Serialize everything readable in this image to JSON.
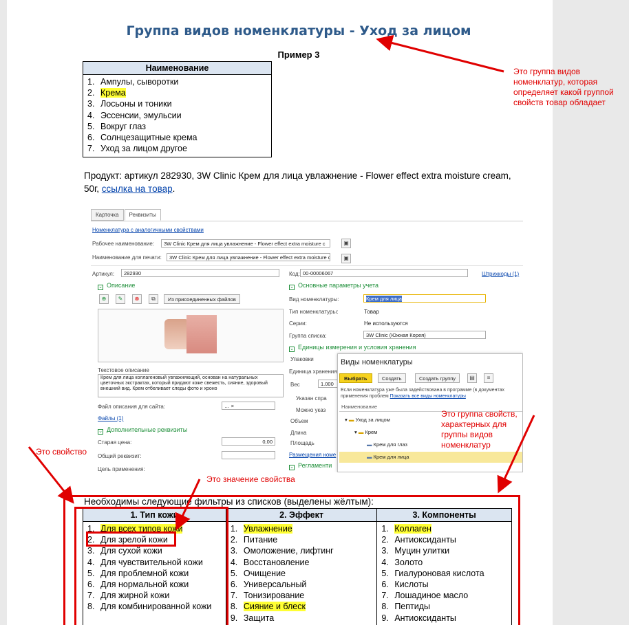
{
  "title": "Группа видов номенклатуры - Уход за лицом",
  "example": "Пример 3",
  "table1": {
    "header": "Наименование",
    "items": [
      {
        "n": "1.",
        "text": "Ампулы, сыворотки",
        "hl": false
      },
      {
        "n": "2.",
        "text": "Крема",
        "hl": true
      },
      {
        "n": "3.",
        "text": "Лосьоны и тоники",
        "hl": false
      },
      {
        "n": "4.",
        "text": "Эссенсии, эмульсии",
        "hl": false
      },
      {
        "n": "5.",
        "text": "Вокруг глаз",
        "hl": false
      },
      {
        "n": "6.",
        "text": "Солнцезащитные крема",
        "hl": false
      },
      {
        "n": "7.",
        "text": "Уход за лицом другое",
        "hl": false
      }
    ]
  },
  "product": {
    "text": "Продукт: артикул 282930, 3W Clinic Крем для лица увлажнение - Flower effect extra moisture cream, 50г, ",
    "link": "ссылка на товар",
    "after": "."
  },
  "screenshot": {
    "tabs": [
      "Карточка",
      "Реквизиты"
    ],
    "link_similar": "Номенклатура с аналогичными свойствами",
    "work_name_label": "Рабочее наименование:",
    "work_name_value": "3W Clinic Крем для лица увлажнение - Flower effect extra moisture c",
    "print_name_label": "Наименование для печати:",
    "print_name_value": "3W Clinic Крем для лица увлажнение - Flower effect extra moisture c",
    "article_label": "Артикул:",
    "article_value": "282930",
    "code_label": "Код:",
    "code_value": "00-00006067",
    "barcodes_link": "Штрихкоды (1)",
    "section_desc": "Описание",
    "from_files_btn": "Из присоединенных файлов",
    "section_main": "Основные параметры учета",
    "kind_label": "Вид номенклатуры:",
    "kind_value": "Крем для лица",
    "type_label": "Тип номенклатуры:",
    "type_value": "Товар",
    "series_label": "Серии:",
    "series_value": "Не используются",
    "group_label": "Группа списка:",
    "group_value": "3W Clinic (Южная Корея)",
    "section_units": "Единицы измерения и условия хранения",
    "pack_label": "Упаковки",
    "unit_label": "Единица хранения",
    "weight_label": "Вес",
    "weight_value": "1.000",
    "radio1": "Указан спра",
    "radio2": "Можно указ",
    "volume_label": "Объем",
    "length_label": "Длина",
    "area_label": "Площадь",
    "placement_link": "Размещения номе",
    "section_reg": "Регламенти",
    "text_desc_label": "Текстовое описание",
    "text_desc": "Крем для лица коллагеновый увлажняющий, основан на натуральных цветочных экстрактах, который придают коже свежесть, сияние, здоровый внешний вид. Крем отбеливает следы фото и хроно",
    "file_desc_label": "Файл описания для сайта:",
    "files_link": "Файлы (1)",
    "section_extra": "Дополнительные реквизиты",
    "old_price_label": "Старая цена:",
    "old_price_value": "0,00",
    "common_attr_label": "Общий реквизит:",
    "purpose_label": "Цель применения:",
    "popup": {
      "title": "Виды номенклатуры",
      "select_btn": "Выбрать",
      "create_btn": "Создать",
      "create_group_btn": "Создать группу",
      "note": "Если номенклатура уже была задействована в программе (в документах применения проблем ",
      "note_link": "Показать все виды номенклатуры",
      "col": "Наименование",
      "rows": [
        "Уход за лицом",
        "Крем",
        "Крем для глаз",
        "Крем для лица"
      ]
    }
  },
  "annotations": {
    "group_note": "Это группа видов номенклатур, которая определяет какой группой свойств товар обладает",
    "props_note": "Это группа свойств, характерных для группы видов номенклатур",
    "property_note": "Это свойство",
    "value_note": "Это значение свойства"
  },
  "need_text": "Необходимы следующие фильтры из списков (выделены жёлтым):",
  "table2": {
    "headers": [
      "1. Тип кожи",
      "2. Эффект",
      "3. Компоненты"
    ],
    "col1": [
      {
        "n": "1.",
        "text": "Для всех типов кожи",
        "hl": true
      },
      {
        "n": "2.",
        "text": "Для зрелой кожи",
        "hl": false
      },
      {
        "n": "3.",
        "text": "Для сухой кожи",
        "hl": false
      },
      {
        "n": "4.",
        "text": "Для чувствительной кожи",
        "hl": false
      },
      {
        "n": "5.",
        "text": "Для проблемной кожи",
        "hl": false
      },
      {
        "n": "6.",
        "text": "Для нормальной кожи",
        "hl": false
      },
      {
        "n": "7.",
        "text": "Для жирной кожи",
        "hl": false
      },
      {
        "n": "8.",
        "text": "Для комбинированной кожи",
        "hl": false
      }
    ],
    "col2": [
      {
        "n": "1.",
        "text": "Увлажнение",
        "hl": true
      },
      {
        "n": "2.",
        "text": "Питание",
        "hl": false
      },
      {
        "n": "3.",
        "text": "Омоложение, лифтинг",
        "hl": false
      },
      {
        "n": "4.",
        "text": "Восстановление",
        "hl": false
      },
      {
        "n": "5.",
        "text": "Очищение",
        "hl": false
      },
      {
        "n": "6.",
        "text": "Универсальный",
        "hl": false
      },
      {
        "n": "7.",
        "text": "Тонизирование",
        "hl": false
      },
      {
        "n": "8.",
        "text": "Сияние и блеск",
        "hl": true
      },
      {
        "n": "9.",
        "text": "Защита",
        "hl": false
      }
    ],
    "col3": [
      {
        "n": "1.",
        "text": "Коллаген",
        "hl": true
      },
      {
        "n": "2.",
        "text": "Антиоксиданты",
        "hl": false
      },
      {
        "n": "3.",
        "text": "Муцин улитки",
        "hl": false
      },
      {
        "n": "4.",
        "text": "Золото",
        "hl": false
      },
      {
        "n": "5.",
        "text": "Гиалуроновая кислота",
        "hl": false
      },
      {
        "n": "6.",
        "text": "Кислоты",
        "hl": false
      },
      {
        "n": "7.",
        "text": "Лошадиное масло",
        "hl": false
      },
      {
        "n": "8.",
        "text": "Пептиды",
        "hl": false
      },
      {
        "n": "9.",
        "text": "Антиоксиданты",
        "hl": false
      }
    ]
  }
}
